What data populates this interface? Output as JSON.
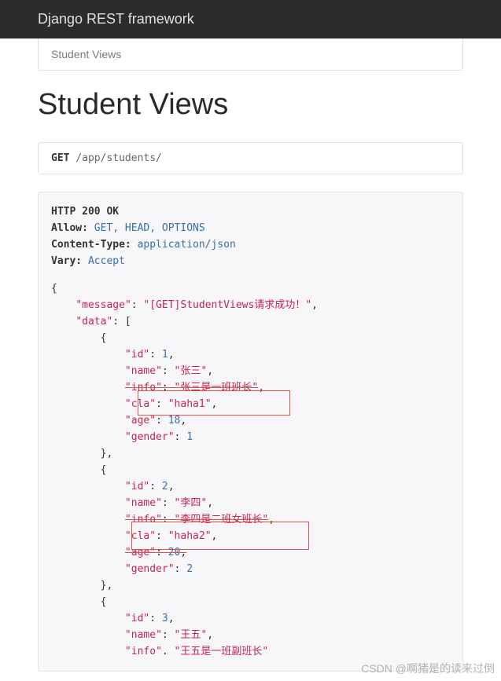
{
  "navbar": {
    "brand": "Django REST framework"
  },
  "breadcrumb": {
    "current": "Student Views"
  },
  "page": {
    "title": "Student Views"
  },
  "request": {
    "method": "GET",
    "path": "/app/students/"
  },
  "response": {
    "status": "HTTP 200 OK",
    "headers": {
      "allow_label": "Allow:",
      "allow_value": "GET, HEAD, OPTIONS",
      "ctype_label": "Content-Type:",
      "ctype_value": "application/json",
      "vary_label": "Vary:",
      "vary_value": "Accept"
    },
    "body": {
      "message_key": "message",
      "message_val": "[GET]StudentViews请求成功！",
      "data_key": "data",
      "records": [
        {
          "id_key": "id",
          "id_val": "1",
          "name_key": "name",
          "name_val": "张三",
          "info_key": "info",
          "info_val": "张三是一班班长",
          "cla_key": "cla",
          "cla_val": "haha1",
          "age_key": "age",
          "age_val": "18",
          "gender_key": "gender",
          "gender_val": "1"
        },
        {
          "id_key": "id",
          "id_val": "2",
          "name_key": "name",
          "name_val": "李四",
          "info_key": "info",
          "info_val": "李四是二班女班长",
          "cla_key": "cla",
          "cla_val": "haha2",
          "age_key": "age",
          "age_val": "20",
          "gender_key": "gender",
          "gender_val": "2"
        },
        {
          "id_key": "id",
          "id_val": "3",
          "name_key": "name",
          "name_val": "王五",
          "info_key": "info",
          "info_val": "王五是一班副班长"
        }
      ]
    }
  },
  "watermark": "CSDN @啊猪是的读来过倒"
}
